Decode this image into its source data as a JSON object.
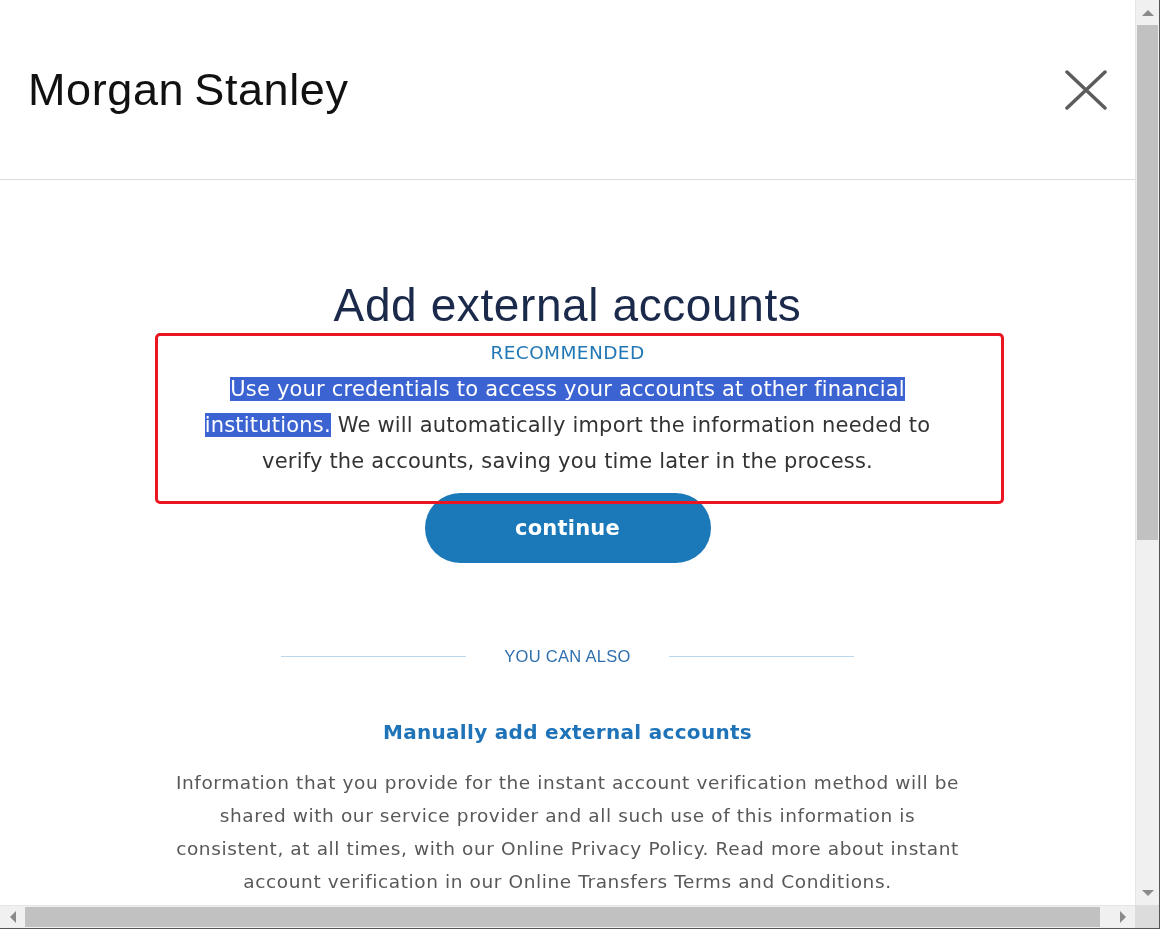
{
  "header": {
    "logo": "Morgan Stanley"
  },
  "title": "Add external accounts",
  "recommended": {
    "label": "RECOMMENDED",
    "description": [
      {
        "text": "Use your credentials to access your accounts at other financial institutions.",
        "selected": true
      },
      {
        "text": " We will automatically import the information needed to verify the accounts, saving you time later in the process.",
        "selected": false
      }
    ],
    "button": "continue"
  },
  "alternatives": {
    "divider_label": "YOU CAN ALSO",
    "link": "Manually add external accounts",
    "text": "Information that you provide for the instant account verification method will be shared with our service provider and all such use of this information is consistent, at all times, with our Online Privacy Policy. Read more about instant account verification in our Online Transfers Terms and Conditions."
  }
}
